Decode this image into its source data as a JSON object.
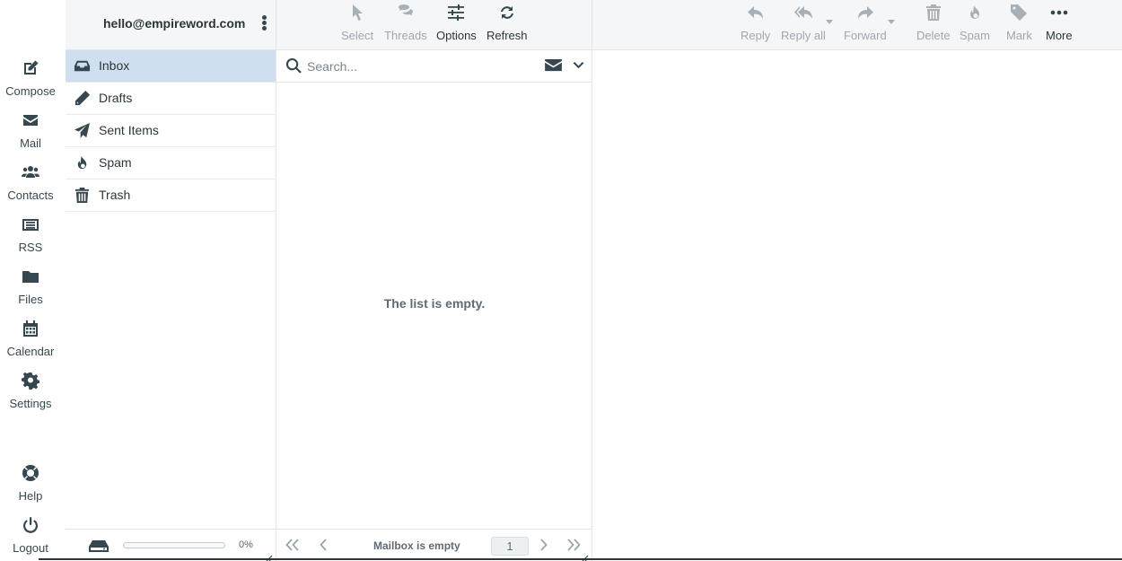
{
  "account": {
    "email": "hello@empireword.com"
  },
  "taskmenu": [
    {
      "label": "Compose",
      "icon": "compose-icon"
    },
    {
      "label": "Mail",
      "icon": "envelope-icon"
    },
    {
      "label": "Contacts",
      "icon": "users-icon"
    },
    {
      "label": "RSS",
      "icon": "rss-list-icon"
    },
    {
      "label": "Files",
      "icon": "folder-icon"
    },
    {
      "label": "Calendar",
      "icon": "calendar-icon"
    },
    {
      "label": "Settings",
      "icon": "gear-icon"
    },
    {
      "label": "Help",
      "icon": "lifebuoy-icon"
    },
    {
      "label": "Logout",
      "icon": "power-icon"
    }
  ],
  "folders": [
    {
      "label": "Inbox",
      "icon": "inbox-icon",
      "selected": true
    },
    {
      "label": "Drafts",
      "icon": "pencil-icon",
      "selected": false
    },
    {
      "label": "Sent Items",
      "icon": "paper-plane-icon",
      "selected": false
    },
    {
      "label": "Spam",
      "icon": "fire-icon",
      "selected": false
    },
    {
      "label": "Trash",
      "icon": "trash-icon",
      "selected": false
    }
  ],
  "quota": {
    "percent_text": "0%",
    "used_fraction": 0
  },
  "list_toolbar": {
    "select": "Select",
    "threads": "Threads",
    "options": "Options",
    "refresh": "Refresh"
  },
  "search": {
    "placeholder": "Search..."
  },
  "list": {
    "empty_message": "The list is empty."
  },
  "list_footer": {
    "count_text": "Mailbox is empty",
    "page": "1"
  },
  "message_toolbar": {
    "reply": "Reply",
    "reply_all": "Reply all",
    "forward": "Forward",
    "delete": "Delete",
    "spam": "Spam",
    "mark": "Mark",
    "more": "More"
  },
  "colors": {
    "selected_folder_bg": "#cfdff0",
    "toolbar_bg": "#f4f6f8",
    "disabled": "#a0a8ae"
  }
}
